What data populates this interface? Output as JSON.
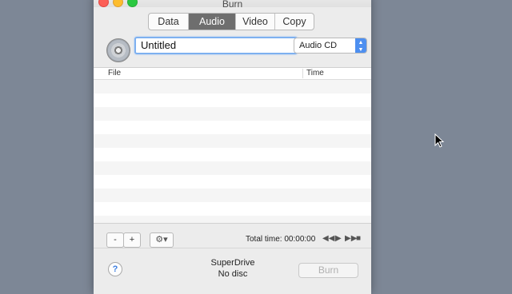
{
  "window": {
    "title": "Burn"
  },
  "tabs": [
    {
      "label": "Data",
      "active": false
    },
    {
      "label": "Audio",
      "active": true
    },
    {
      "label": "Video",
      "active": false
    },
    {
      "label": "Copy",
      "active": false
    }
  ],
  "disc_name": {
    "value": "Untitled"
  },
  "format_select": {
    "value": "Audio CD"
  },
  "table": {
    "columns": [
      "File",
      "Time"
    ],
    "rows": []
  },
  "toolbar": {
    "remove_label": "-",
    "add_label": "+",
    "gear_icon": "gear-icon",
    "total_time": "Total time: 00:00:00"
  },
  "transport": {
    "rewind_icon": "rewind-icon",
    "play_icon": "play-icon",
    "fast_forward_icon": "fast-forward-icon",
    "stop_icon": "stop-icon"
  },
  "status": {
    "drive": "SuperDrive",
    "disc": "No disc"
  },
  "help": {
    "label": "?"
  },
  "burn_button": {
    "label": "Burn",
    "enabled": false
  },
  "colors": {
    "desktop": "#7d8796",
    "accent": "#4d8ff0",
    "active_tab": "#6e6e6e"
  }
}
